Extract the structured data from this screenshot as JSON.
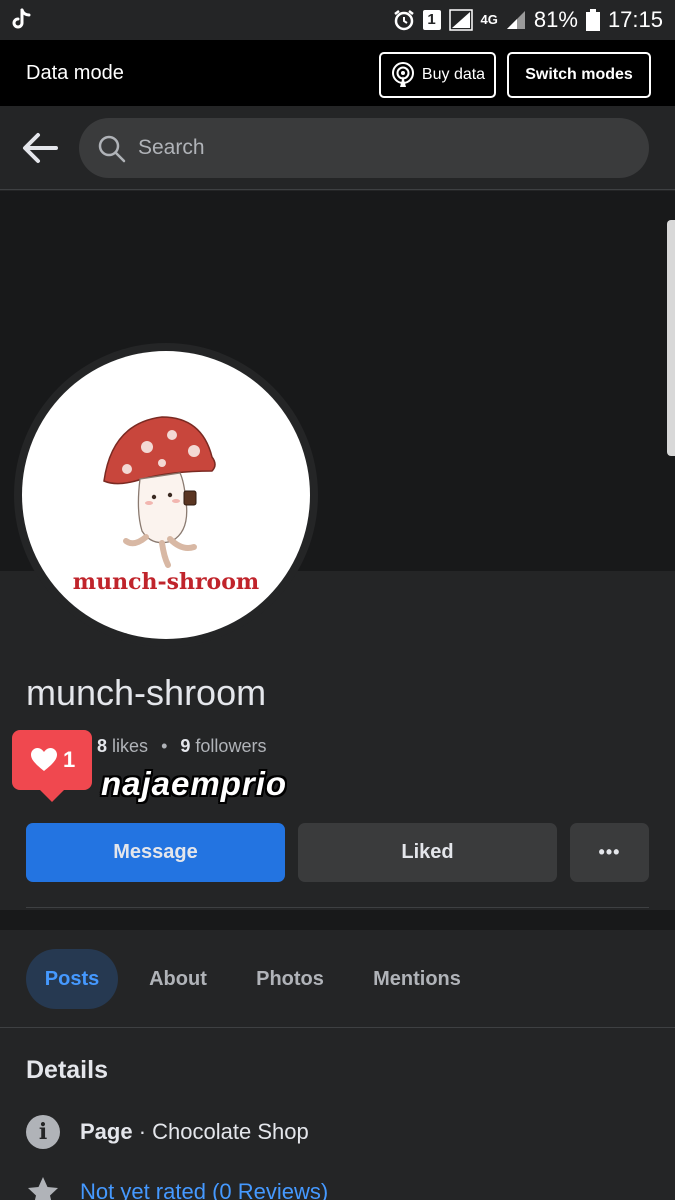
{
  "status_bar": {
    "app_icon": "tiktok-icon",
    "notification_count": "1",
    "network": "4G",
    "battery": "81%",
    "time": "17:15"
  },
  "data_mode": {
    "label": "Data mode",
    "buy_data": "Buy data",
    "switch_modes": "Switch modes"
  },
  "search": {
    "placeholder": "Search"
  },
  "profile": {
    "logo_text": "munch-shroom",
    "name": "munch-shroom",
    "likes_count": "8",
    "likes_label": "likes",
    "followers_count": "9",
    "followers_label": "followers",
    "separator": "•"
  },
  "notification_bubble": {
    "count": "1",
    "icon": "heart-icon"
  },
  "watermark": "najaemprio",
  "actions": {
    "message": "Message",
    "liked": "Liked",
    "more": "•••"
  },
  "tabs": [
    {
      "label": "Posts",
      "active": true
    },
    {
      "label": "About",
      "active": false
    },
    {
      "label": "Photos",
      "active": false
    },
    {
      "label": "Mentions",
      "active": false
    }
  ],
  "details": {
    "heading": "Details",
    "page_label": "Page",
    "page_separator": " · ",
    "page_category": "Chocolate Shop",
    "rating_text": "Not yet rated (0 Reviews)"
  },
  "colors": {
    "accent_blue": "#2374e1",
    "link_blue": "#4599ff",
    "background": "#242526",
    "notification_red": "#f0484f",
    "brand_red": "#c0242b"
  }
}
